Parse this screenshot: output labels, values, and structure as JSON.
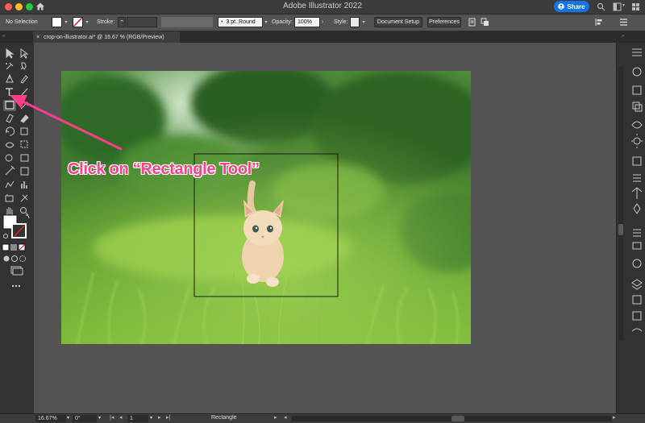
{
  "window": {
    "title": "Adobe Illustrator 2022",
    "share_label": "Share"
  },
  "controlbar": {
    "selection": "No Selection",
    "stroke_label": "Stroke:",
    "brush": "3 pt. Round",
    "opacity_label": "Opacity:",
    "opacity_value": "100%",
    "style_label": "Style:",
    "document_setup": "Document Setup",
    "preferences": "Preferences"
  },
  "tab": {
    "close": "×",
    "label": "crop-on-illustrator.ai* @ 16.67 % (RGB/Preview)"
  },
  "annotation": {
    "text": "Click on “Rectangle Tool”"
  },
  "statusbar": {
    "zoom": "16.67%",
    "rotation": "0°",
    "artboard_number": "1",
    "tool_name": "Rectangle"
  },
  "colors": {
    "accent": "#1473e6",
    "annotation": "#ff3d8a",
    "canvas": "#535353",
    "panel": "#323232"
  }
}
